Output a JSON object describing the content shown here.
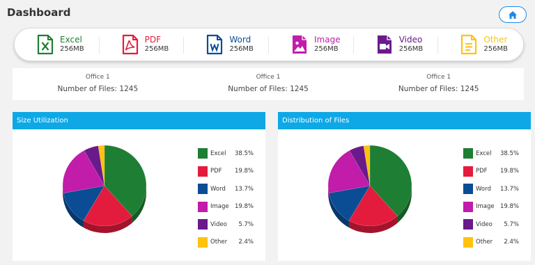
{
  "header": {
    "title": "Dashboard"
  },
  "file_types": [
    {
      "name": "Excel",
      "size": "256MB",
      "color": "#1e7e34",
      "icon": "excel-icon"
    },
    {
      "name": "PDF",
      "size": "256MB",
      "color": "#e31c3d",
      "icon": "pdf-icon"
    },
    {
      "name": "Word",
      "size": "256MB",
      "color": "#0b4d94",
      "icon": "word-icon"
    },
    {
      "name": "Image",
      "size": "256MB",
      "color": "#c11caa",
      "icon": "image-icon"
    },
    {
      "name": "Video",
      "size": "256MB",
      "color": "#6a1a8a",
      "icon": "video-icon"
    },
    {
      "name": "Other",
      "size": "256MB",
      "color": "#ffc20e",
      "icon": "other-file-icon"
    }
  ],
  "offices": [
    {
      "name": "Office 1",
      "files": "Number of Files: 1245"
    },
    {
      "name": "Office 1",
      "files": "Number of Files: 1245"
    },
    {
      "name": "Office 1",
      "files": "Number of Files: 1245"
    }
  ],
  "panels": {
    "size_title": "Size Utilization",
    "distribution_title": "Distribution of Files"
  },
  "chart_data": [
    {
      "type": "pie",
      "title": "Size Utilization",
      "categories": [
        "Excel",
        "PDF",
        "Word",
        "Image",
        "Video",
        "Other"
      ],
      "values": [
        38.5,
        19.8,
        13.7,
        19.8,
        5.7,
        2.4
      ],
      "labels": [
        "38.5%",
        "19.8%",
        "13.7%",
        "19.8%",
        "5.7%",
        "2.4%"
      ],
      "colors": [
        "#1e7e34",
        "#e31c3d",
        "#0b4d94",
        "#c11caa",
        "#6a1a8a",
        "#ffc20e"
      ],
      "legend": "right"
    },
    {
      "type": "pie",
      "title": "Distribution of Files",
      "categories": [
        "Excel",
        "PDF",
        "Word",
        "Image",
        "Video",
        "Other"
      ],
      "values": [
        38.5,
        19.8,
        13.7,
        19.8,
        5.7,
        2.4
      ],
      "labels": [
        "38.5%",
        "19.8%",
        "13.7%",
        "19.8%",
        "5.7%",
        "2.4%"
      ],
      "colors": [
        "#1e7e34",
        "#e31c3d",
        "#0b4d94",
        "#c11caa",
        "#6a1a8a",
        "#ffc20e"
      ],
      "legend": "right"
    }
  ]
}
